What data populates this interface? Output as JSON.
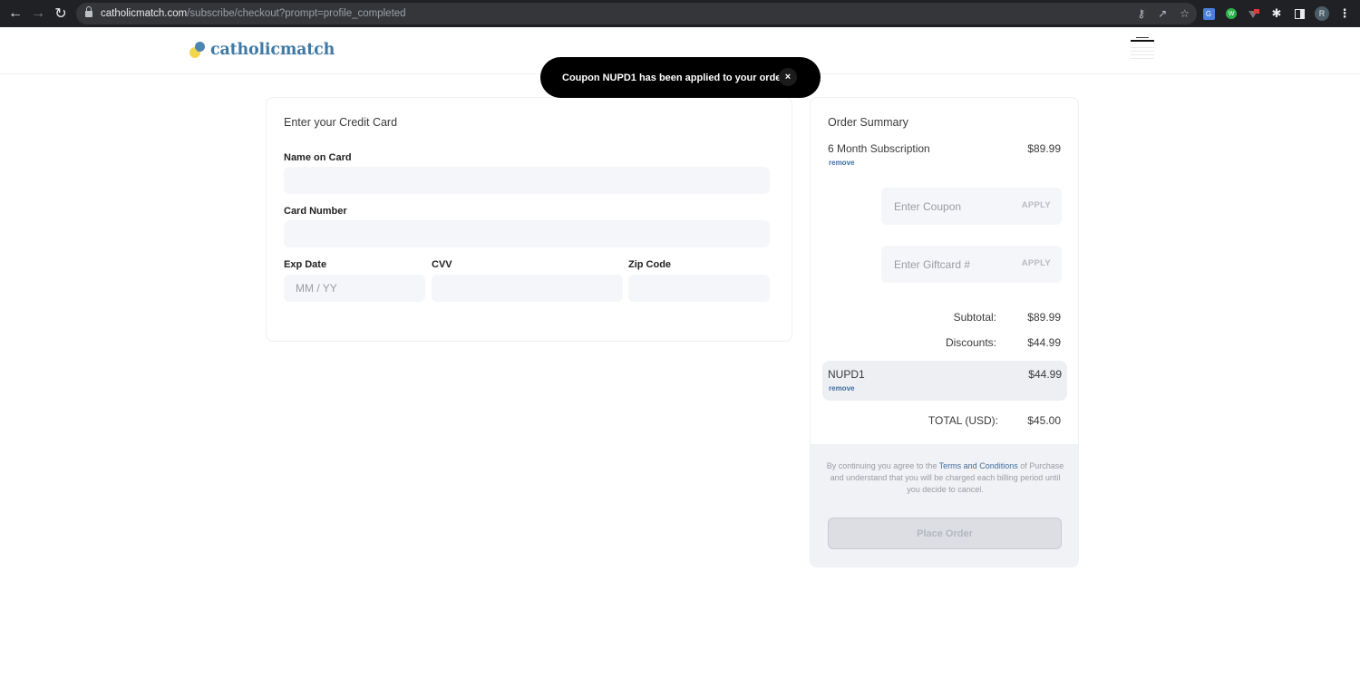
{
  "browser": {
    "url_host": "catholicmatch.com",
    "url_path": "/subscribe/checkout?prompt=profile_completed",
    "profile_initial": "R",
    "icons": [
      "back-icon",
      "forward-icon",
      "reload-icon",
      "lock-icon",
      "key-icon",
      "share-icon",
      "star-icon",
      "translate-extension-icon",
      "green-extension-icon",
      "red-extension-icon",
      "puzzle-icon",
      "side-panel-icon",
      "menu-icon"
    ]
  },
  "site": {
    "logo_text": "catholicmatch",
    "brand_colors": {
      "blue": "#3f7aa6",
      "yellow": "#f2d54b"
    }
  },
  "toast": {
    "message": "Coupon NUPD1 has been applied to your order.",
    "close_symbol": "×"
  },
  "card_form": {
    "title": "Enter your Credit Card",
    "fields": {
      "name": {
        "label": "Name on Card",
        "value": "",
        "placeholder": ""
      },
      "number": {
        "label": "Card Number",
        "value": "",
        "placeholder": ""
      },
      "exp": {
        "label": "Exp Date",
        "value": "",
        "placeholder": "MM / YY"
      },
      "cvv": {
        "label": "CVV",
        "value": "",
        "placeholder": ""
      },
      "zip": {
        "label": "Zip Code",
        "value": "",
        "placeholder": ""
      }
    }
  },
  "summary": {
    "title": "Order Summary",
    "item": {
      "name": "6 Month Subscription",
      "price": "$89.99",
      "remove_label": "remove"
    },
    "coupon_input": {
      "placeholder": "Enter Coupon",
      "value": "",
      "apply_label": "APPLY"
    },
    "giftcard_input": {
      "placeholder": "Enter Giftcard #",
      "value": "",
      "apply_label": "APPLY"
    },
    "subtotal": {
      "label": "Subtotal:",
      "value": "$89.99"
    },
    "discounts": {
      "label": "Discounts:",
      "value": "$44.99"
    },
    "applied_coupon": {
      "code": "NUPD1",
      "amount": "$44.99",
      "remove_label": "remove"
    },
    "total": {
      "label": "TOTAL (USD):",
      "value": "$45.00"
    },
    "legal": {
      "prefix": "By continuing you agree to the ",
      "link": "Terms and Conditions",
      "suffix": " of Purchase and understand that you will be charged each billing period until you decide to cancel."
    },
    "place_order_label": "Place Order"
  }
}
